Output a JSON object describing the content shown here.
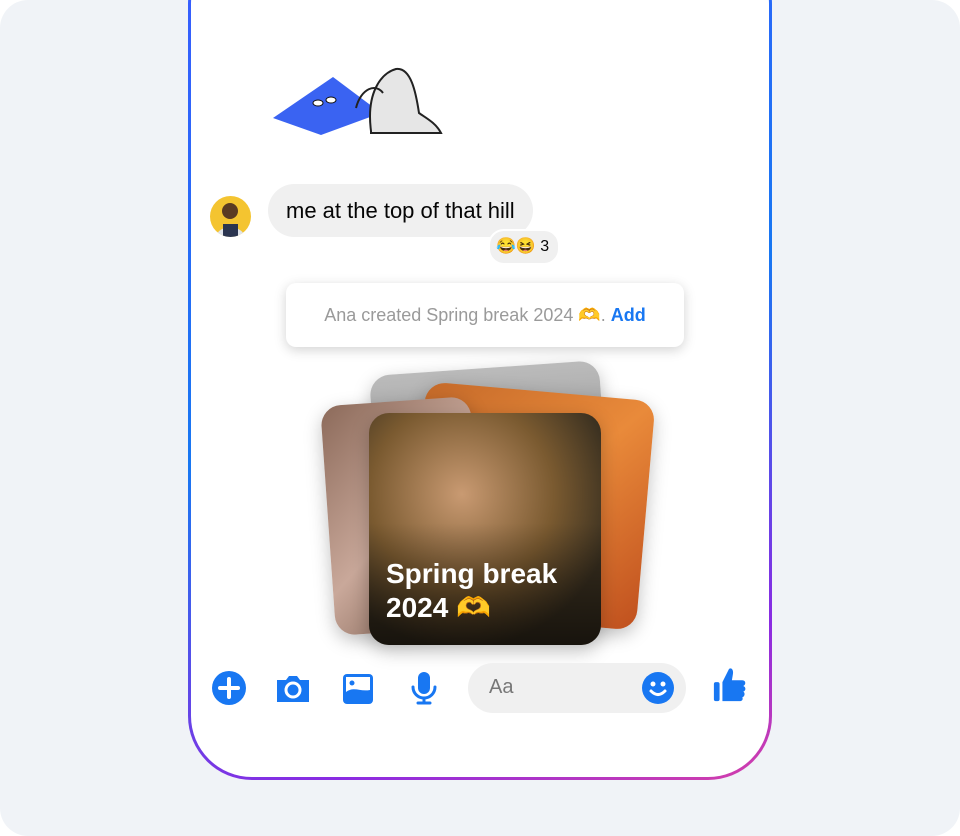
{
  "message": {
    "text": "me at the top of that hill",
    "reactions": "😂😆",
    "reaction_count": "3"
  },
  "notice": {
    "text": "Ana created Spring break 2024 🫶.",
    "action": "Add"
  },
  "album": {
    "title_line1": "Spring break",
    "title_line2": "2024 🫶"
  },
  "composer": {
    "placeholder": "Aa"
  },
  "colors": {
    "accent": "#1877f2",
    "bubble": "#f0f0f0",
    "background": "#f0f3f7"
  },
  "icons": [
    "plus-icon",
    "camera-icon",
    "image-icon",
    "microphone-icon",
    "emoji-icon",
    "thumbs-up-icon"
  ]
}
